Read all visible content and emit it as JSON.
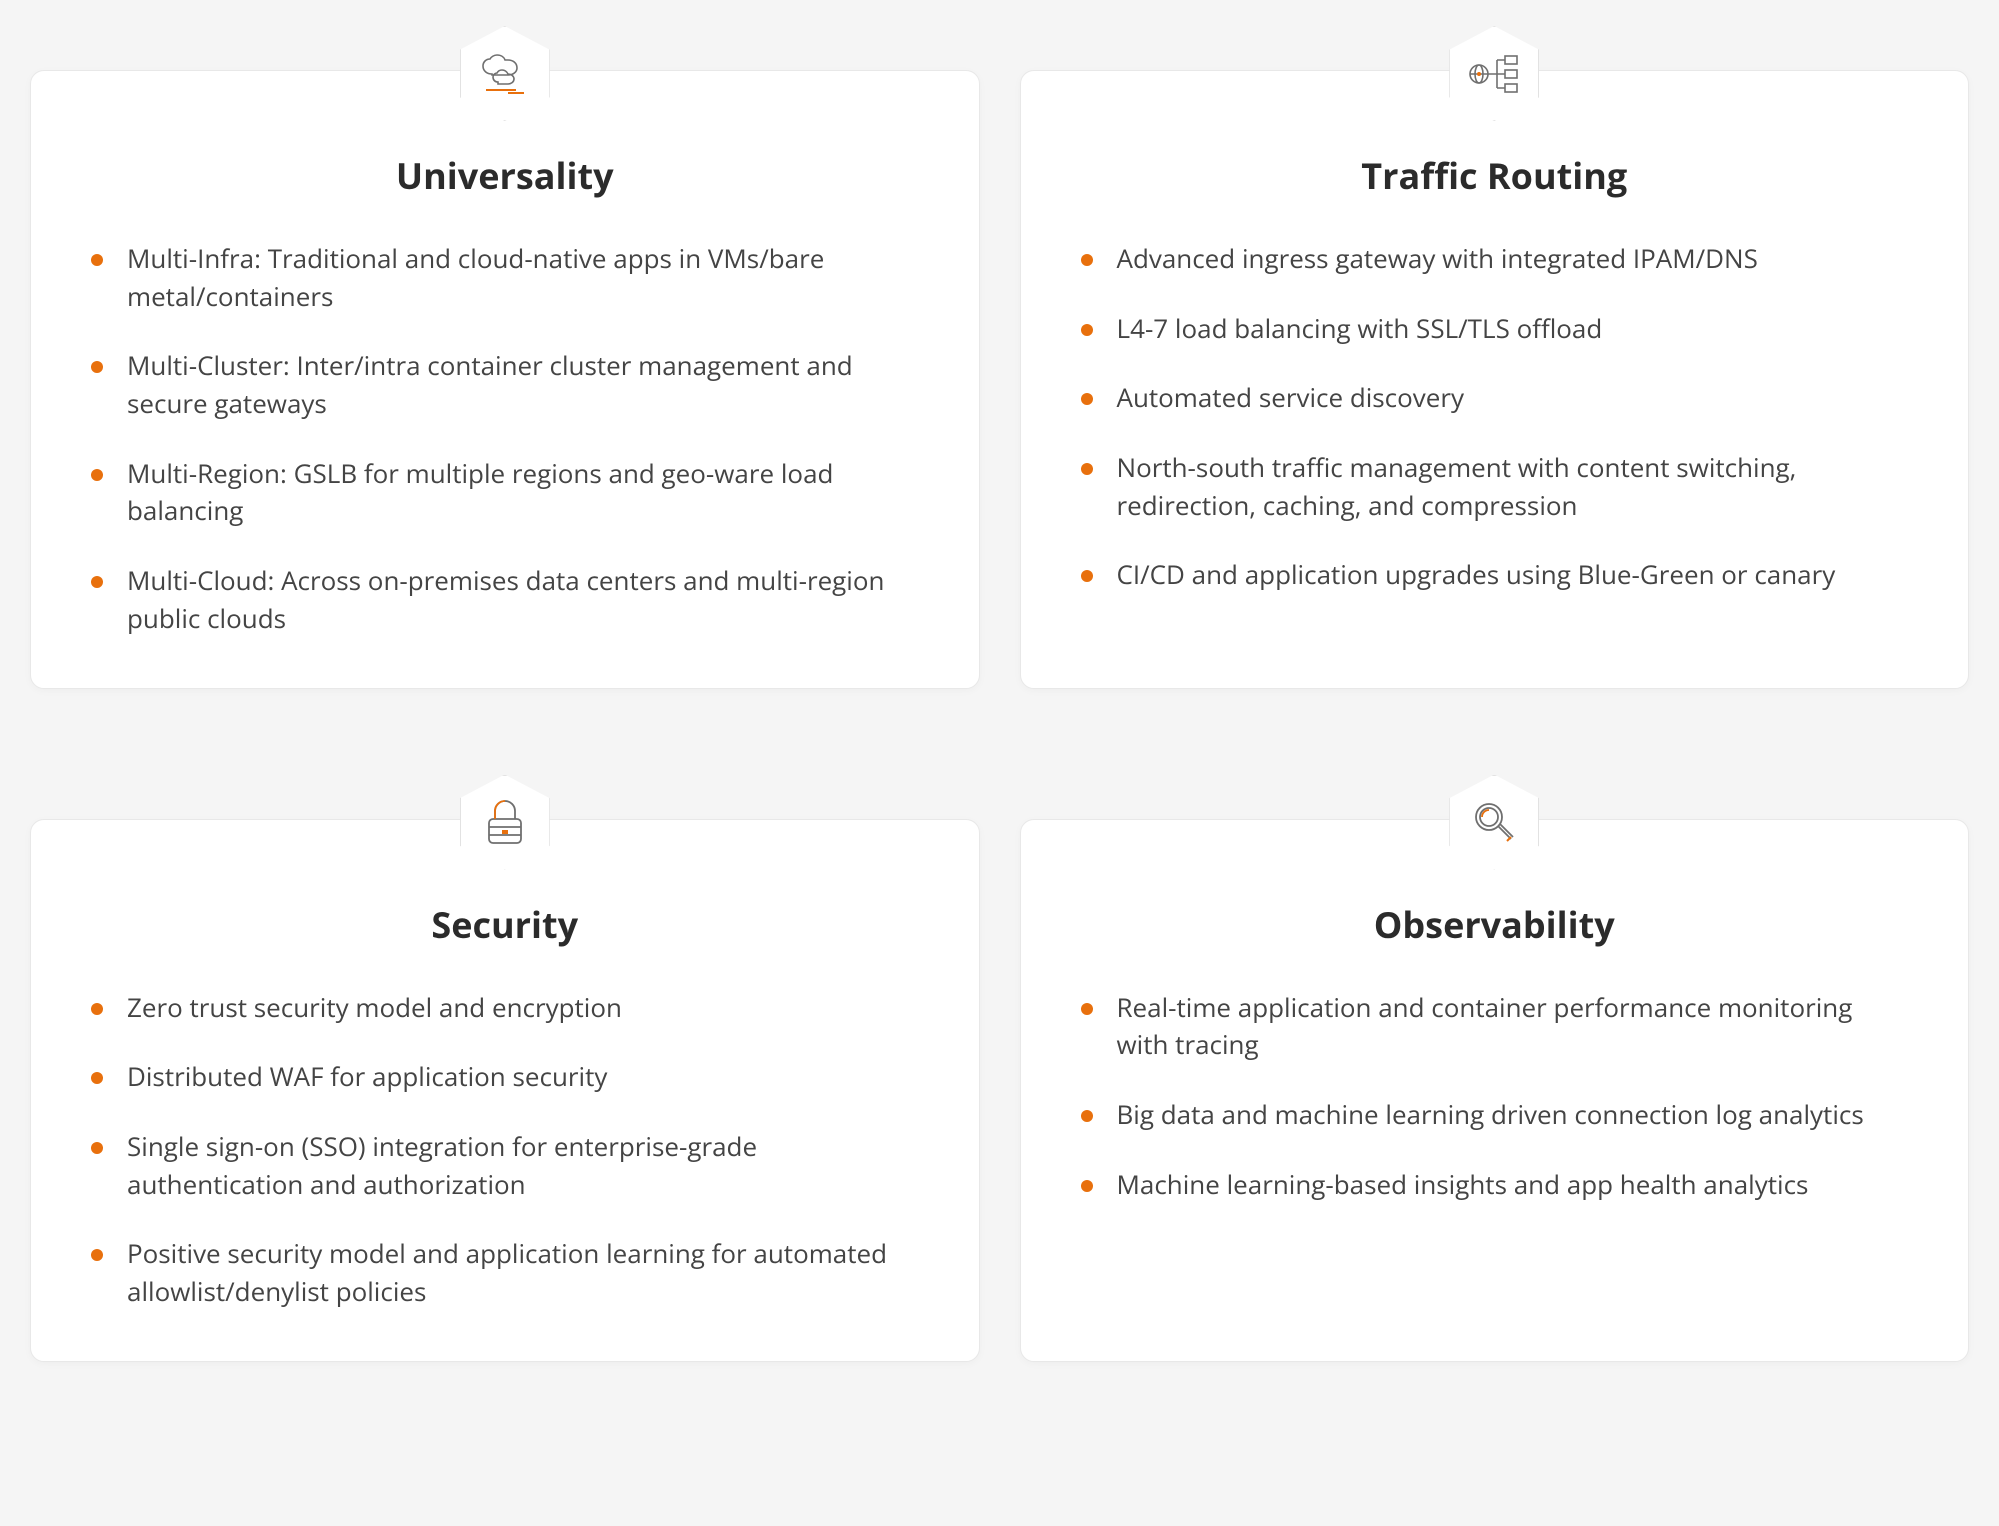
{
  "colors": {
    "bullet": "#e8700d",
    "card_bg": "#ffffff",
    "page_bg": "#f5f5f5",
    "text": "#333333",
    "icon_accent": "#e8700d",
    "icon_stroke": "#6f6f6f"
  },
  "cards": [
    {
      "id": "universality",
      "icon": "cloud-icon",
      "title": "Universality",
      "items": [
        "Multi-Infra: Traditional and cloud-native apps in VMs/bare metal/containers",
        "Multi-Cluster: Inter/intra container cluster management and secure gateways",
        "Multi-Region: GSLB for multiple regions and geo-ware load balancing",
        "Multi-Cloud: Across on-premises data centers and multi-region public clouds"
      ]
    },
    {
      "id": "traffic-routing",
      "icon": "routing-icon",
      "title": "Traffic Routing",
      "items": [
        "Advanced ingress gateway with integrated IPAM/DNS",
        "L4-7 load balancing with SSL/TLS offload",
        "Automated service discovery",
        "North-south traffic management with content switching, redirection, caching, and compression",
        "CI/CD and application upgrades using Blue-Green or canary"
      ]
    },
    {
      "id": "security",
      "icon": "lock-icon",
      "title": "Security",
      "items": [
        "Zero trust security model and encryption",
        "Distributed WAF for application security",
        "Single sign-on (SSO) integration for enterprise-grade authentication and authorization",
        "Positive security model and application learning for automated allowlist/denylist policies"
      ]
    },
    {
      "id": "observability",
      "icon": "magnify-icon",
      "title": "Observability",
      "items": [
        "Real-time application and container performance monitoring with tracing",
        "Big data and machine learning driven connection log analytics",
        "Machine learning-based insights and app health analytics"
      ]
    }
  ]
}
